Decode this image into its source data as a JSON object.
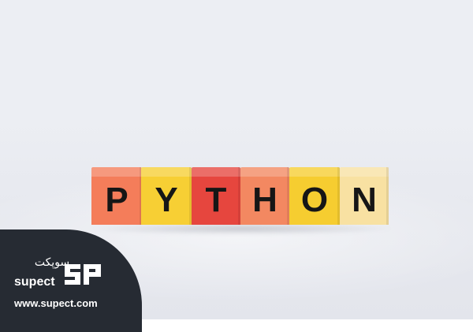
{
  "scene": {
    "blocks": [
      {
        "letter": "P",
        "color": "#f47d5a"
      },
      {
        "letter": "Y",
        "color": "#f7cf34"
      },
      {
        "letter": "T",
        "color": "#e6463e"
      },
      {
        "letter": "H",
        "color": "#f38861"
      },
      {
        "letter": "O",
        "color": "#f6cd30"
      },
      {
        "letter": "N",
        "color": "#f8e1a2"
      }
    ]
  },
  "watermark": {
    "brand_fa": "سوپکت",
    "brand_en": "supect",
    "url": "www.supect.com",
    "badge_color": "#262b33",
    "logo_icon": "sp-logo"
  }
}
